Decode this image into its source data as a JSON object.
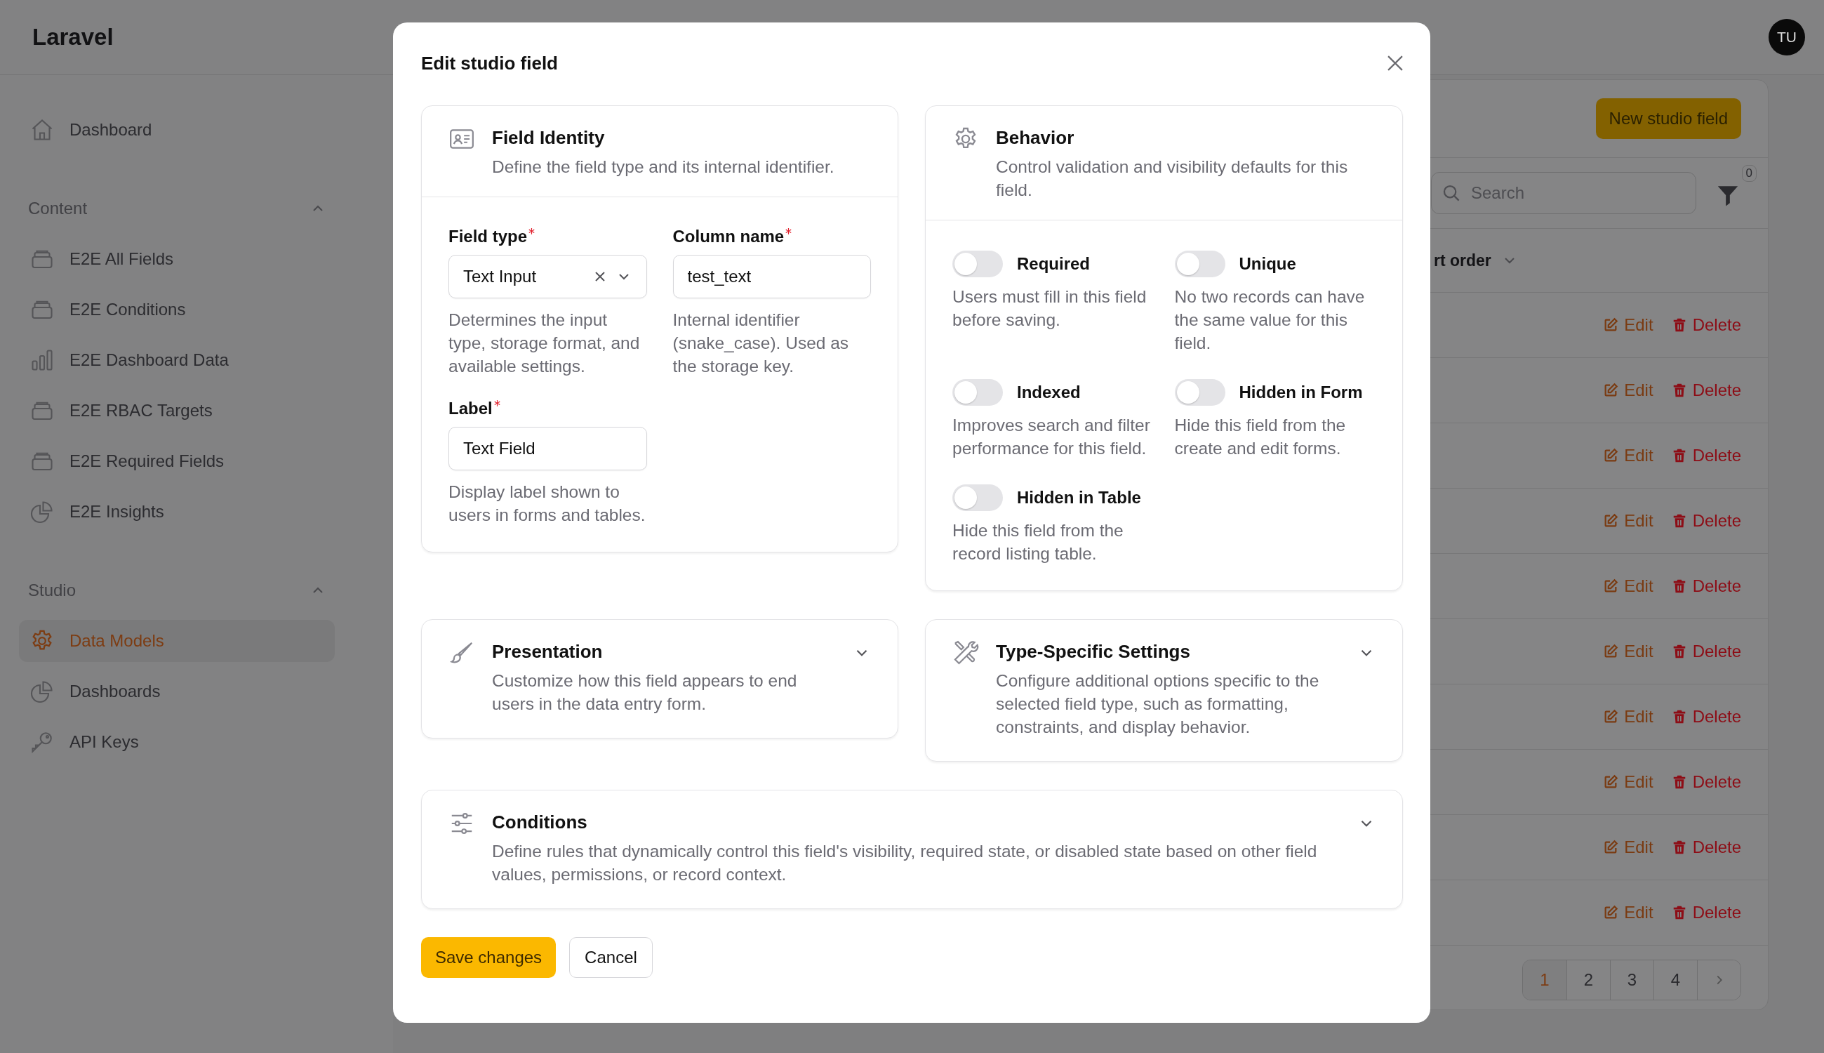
{
  "app": {
    "brand": "Laravel",
    "avatar": "TU"
  },
  "sidebar": {
    "items": [
      {
        "label": "Dashboard",
        "kind": "home",
        "selected": false
      }
    ],
    "groups": [
      {
        "title": "Content",
        "expanded": true,
        "items": [
          {
            "label": "E2E All Fields",
            "kind": "stack",
            "selected": false
          },
          {
            "label": "E2E Conditions",
            "kind": "stack",
            "selected": false
          },
          {
            "label": "E2E Dashboard Data",
            "kind": "bars",
            "selected": false
          },
          {
            "label": "E2E RBAC Targets",
            "kind": "stack",
            "selected": false
          },
          {
            "label": "E2E Required Fields",
            "kind": "stack",
            "selected": false
          },
          {
            "label": "E2E Insights",
            "kind": "pie",
            "selected": false
          }
        ]
      },
      {
        "title": "Studio",
        "expanded": true,
        "items": [
          {
            "label": "Data Models",
            "kind": "gear",
            "selected": true
          },
          {
            "label": "Dashboards",
            "kind": "pie",
            "selected": false
          },
          {
            "label": "API Keys",
            "kind": "key",
            "selected": false
          }
        ]
      }
    ]
  },
  "main": {
    "new_button": "New studio field",
    "search": {
      "placeholder": "Search"
    },
    "filter_count": "0",
    "column_header": "rt order",
    "rows": [
      {
        "edit": "Edit",
        "delete": "Delete"
      },
      {
        "edit": "Edit",
        "delete": "Delete"
      },
      {
        "edit": "Edit",
        "delete": "Delete"
      },
      {
        "edit": "Edit",
        "delete": "Delete"
      },
      {
        "edit": "Edit",
        "delete": "Delete"
      },
      {
        "edit": "Edit",
        "delete": "Delete"
      },
      {
        "edit": "Edit",
        "delete": "Delete"
      },
      {
        "edit": "Edit",
        "delete": "Delete"
      },
      {
        "edit": "Edit",
        "delete": "Delete"
      },
      {
        "edit": "Edit",
        "delete": "Delete"
      }
    ],
    "pagination": [
      {
        "label": "1",
        "selected": true
      },
      {
        "label": "2",
        "selected": false
      },
      {
        "label": "3",
        "selected": false
      },
      {
        "label": "4",
        "selected": false
      }
    ]
  },
  "modal": {
    "title": "Edit studio field",
    "identity": {
      "title": "Field Identity",
      "description": "Define the field type and its internal identifier.",
      "fields": [
        {
          "kind": "select",
          "label": "Field type",
          "required": true,
          "value": "Text Input",
          "clearable": true,
          "hint": "Determines the input type, storage format, and available settings."
        },
        {
          "kind": "text",
          "label": "Column name",
          "required": true,
          "value": "test_text",
          "hint": "Internal identifier (snake_case). Used as the storage key."
        },
        {
          "kind": "text",
          "label": "Label",
          "required": true,
          "value": "Text Field",
          "hint": "Display label shown to users in forms and tables."
        }
      ]
    },
    "behavior": {
      "title": "Behavior",
      "description": "Control validation and visibility defaults for this field.",
      "toggles": [
        {
          "label": "Required",
          "on": false,
          "hint": "Users must fill in this field before saving."
        },
        {
          "label": "Unique",
          "on": false,
          "hint": "No two records can have the same value for this field."
        },
        {
          "label": "Indexed",
          "on": false,
          "hint": "Improves search and filter performance for this field."
        },
        {
          "label": "Hidden in Form",
          "on": false,
          "hint": "Hide this field from the create and edit forms."
        },
        {
          "label": "Hidden in Table",
          "on": false,
          "hint": "Hide this field from the record listing table."
        }
      ]
    },
    "sections": [
      {
        "kind": "brush",
        "title": "Presentation",
        "description": "Customize how this field appears to end users in the data entry form.",
        "expanded": false
      },
      {
        "kind": "tools",
        "title": "Type-Specific Settings",
        "description": "Configure additional options specific to the selected field type, such as formatting, constraints, and display behavior.",
        "expanded": false
      }
    ],
    "conditions": {
      "kind": "sliders",
      "title": "Conditions",
      "description": "Define rules that dynamically control this field's visibility, required state, or disabled state based on other field values, permissions, or record context.",
      "expanded": false
    },
    "buttons": {
      "save": "Save changes",
      "cancel": "Cancel"
    }
  }
}
